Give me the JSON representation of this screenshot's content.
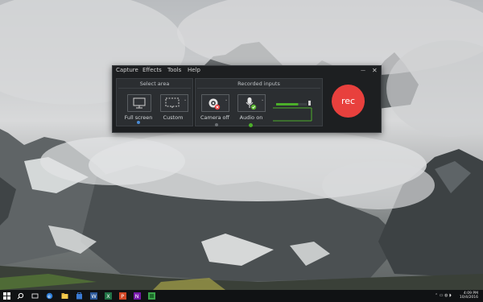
{
  "menu": {
    "capture": "Capture",
    "effects": "Effects",
    "tools": "Tools",
    "help": "Help"
  },
  "window_controls": {
    "minimize": "—",
    "close": "✕"
  },
  "select_area": {
    "title": "Select area",
    "full_screen_label": "Full screen",
    "custom_label": "Custom"
  },
  "recorded_inputs": {
    "title": "Recorded inputs",
    "camera_label": "Camera off",
    "audio_label": "Audio on",
    "audio_level": 0.72
  },
  "rec_button": {
    "label": "rec"
  },
  "taskbar": {
    "time": "4:09 PM",
    "date": "10/4/2016"
  },
  "colors": {
    "rec": "#e8403d",
    "audio_accent": "#4caf2a",
    "window_bg": "#1d1f21"
  },
  "icons": [
    "monitor-icon",
    "custom-region-icon",
    "webcam-icon",
    "camera-off-badge",
    "microphone-icon",
    "audio-on-badge",
    "windows-start-icon",
    "search-icon",
    "task-view-icon",
    "edge-browser-icon",
    "file-explorer-icon",
    "store-icon",
    "word-icon",
    "excel-icon",
    "powerpoint-icon",
    "onenote-icon",
    "camtasia-icon"
  ]
}
